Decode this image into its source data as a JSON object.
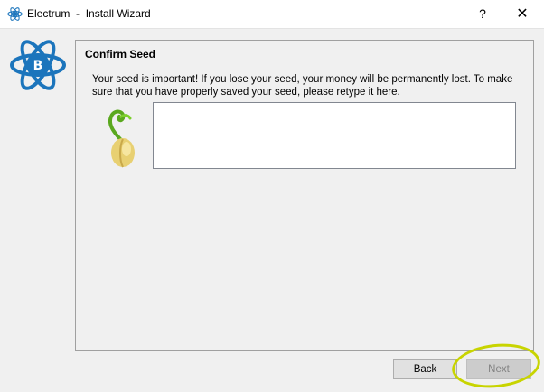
{
  "window": {
    "app_name": "Electrum",
    "separator": "-",
    "title": "Install Wizard",
    "help_label": "?",
    "close_label": "✕"
  },
  "page": {
    "heading": "Confirm Seed",
    "description": "Your seed is important! If you lose your seed, your money will be permanently lost. To make sure that you have properly saved your seed, please retype it here.",
    "seed_input_value": ""
  },
  "buttons": {
    "back_label": "Back",
    "next_label": "Next"
  },
  "colors": {
    "accent": "#1c75bc",
    "highlight": "#c8d400"
  }
}
